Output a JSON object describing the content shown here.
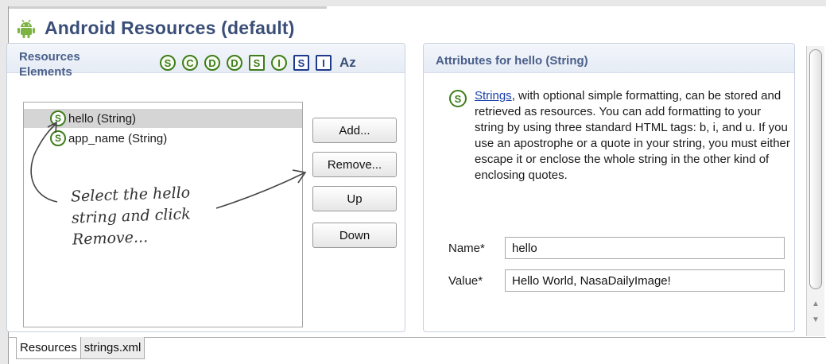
{
  "header": {
    "title": "Android Resources (default)",
    "icon": "android-robot-icon",
    "accent": "#7cb342"
  },
  "left_section": {
    "title": "Resources\nElements",
    "filters": [
      {
        "glyph": "S",
        "shape": "circle",
        "name": "string-filter-icon"
      },
      {
        "glyph": "C",
        "shape": "circle",
        "name": "color-filter-icon"
      },
      {
        "glyph": "D",
        "shape": "circle",
        "name": "dimension-filter-icon"
      },
      {
        "glyph": "D",
        "shape": "circle",
        "name": "drawable-filter-icon"
      },
      {
        "glyph": "S",
        "shape": "square",
        "name": "style-filter-icon"
      },
      {
        "glyph": "I",
        "shape": "circle",
        "name": "integer-filter-icon"
      },
      {
        "glyph": "S",
        "shape": "square-blue",
        "name": "string-array-filter-icon"
      },
      {
        "glyph": "I",
        "shape": "square-blue",
        "name": "integer-array-filter-icon"
      }
    ],
    "sort_label": "Az",
    "items": [
      {
        "icon_glyph": "S",
        "label": "hello (String)",
        "selected": true
      },
      {
        "icon_glyph": "S",
        "label": "app_name (String)",
        "selected": false
      }
    ],
    "buttons": {
      "add": "Add...",
      "remove": "Remove...",
      "up": "Up",
      "down": "Down"
    }
  },
  "annotation": "Select the hello\nstring and click\nRemove...",
  "right_section": {
    "title": "Attributes for hello (String)",
    "desc_icon_glyph": "S",
    "desc_link": "Strings",
    "desc_text": ", with optional simple formatting, can be stored and retrieved as resources. You can add formatting to your string by using three standard HTML tags: b, i, and u. If you use an apostrophe or a quote in your string, you must either escape it or enclose the whole string in the other kind of enclosing quotes.",
    "fields": {
      "name_label": "Name*",
      "name_value": "hello",
      "value_label": "Value*",
      "value_value": "Hello World, NasaDailyImage!"
    }
  },
  "tabs": [
    {
      "label": "Resources",
      "active": true
    },
    {
      "label": "strings.xml",
      "active": false
    }
  ],
  "scroll": {
    "up_arrow": "▲",
    "down_arrow": "▼"
  }
}
